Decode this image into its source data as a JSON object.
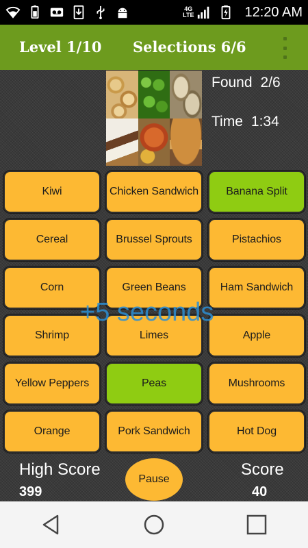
{
  "status_bar": {
    "time": "12:20 AM",
    "network": "4G",
    "network_sub": "LTE",
    "icons": [
      "wifi-icon",
      "battery-small-icon",
      "voicemail-icon",
      "download-icon",
      "usb-icon",
      "android-debug-icon",
      "signal-icon",
      "battery-charging-icon"
    ]
  },
  "app_bar": {
    "level": "Level 1/10",
    "selections": "Selections 6/6"
  },
  "stats": {
    "found_label": "Found",
    "found_value": "2/6",
    "time_label": "Time",
    "time_value": "1:34"
  },
  "collage_images": [
    "cereal",
    "peas",
    "pistachios",
    "banana-split",
    "ham-sandwich",
    "chicken-sandwich"
  ],
  "food_grid": [
    {
      "label": "Kiwi",
      "selected": false
    },
    {
      "label": "Chicken Sandwich",
      "selected": false
    },
    {
      "label": "Banana Split",
      "selected": true
    },
    {
      "label": "Cereal",
      "selected": false
    },
    {
      "label": "Brussel Sprouts",
      "selected": false
    },
    {
      "label": "Pistachios",
      "selected": false
    },
    {
      "label": "Corn",
      "selected": false
    },
    {
      "label": "Green Beans",
      "selected": false
    },
    {
      "label": "Ham Sandwich",
      "selected": false
    },
    {
      "label": "Shrimp",
      "selected": false
    },
    {
      "label": "Limes",
      "selected": false
    },
    {
      "label": "Apple",
      "selected": false
    },
    {
      "label": "Yellow Peppers",
      "selected": false
    },
    {
      "label": "Peas",
      "selected": true
    },
    {
      "label": "Mushrooms",
      "selected": false
    },
    {
      "label": "Orange",
      "selected": false
    },
    {
      "label": "Pork Sandwich",
      "selected": false
    },
    {
      "label": "Hot Dog",
      "selected": false
    }
  ],
  "bonus_text": "+5 seconds",
  "bottom": {
    "high_score_label": "High Score",
    "high_score_value": "399",
    "pause_label": "Pause",
    "score_label": "Score",
    "score_value": "40"
  },
  "colors": {
    "app_bar": "#6d9b1e",
    "button": "#fdb933",
    "button_selected": "#8fcc12",
    "bonus_text": "#2c8fd4"
  },
  "nav_bar": {
    "icons": [
      "back-icon",
      "home-icon",
      "recents-icon"
    ]
  }
}
